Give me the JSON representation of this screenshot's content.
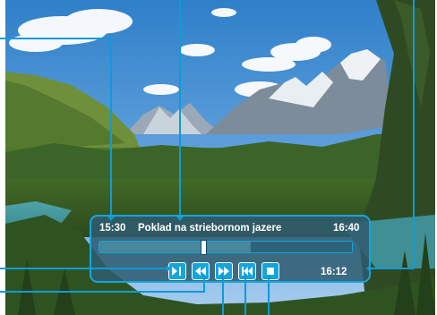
{
  "player": {
    "start_time": "15:30",
    "title": "Poklad na striebornom jazere",
    "end_time": "16:40",
    "current_time": "16:12",
    "progress_fraction": 0.6,
    "handle_fraction": 0.41
  },
  "buttons": [
    {
      "name": "play-pause-button",
      "icon": "play-pause-icon"
    },
    {
      "name": "rewind-button",
      "icon": "rewind-icon"
    },
    {
      "name": "fast-forward-button",
      "icon": "fast-forward-icon"
    },
    {
      "name": "skip-back-button",
      "icon": "skip-back-icon"
    },
    {
      "name": "stop-button",
      "icon": "stop-icon"
    }
  ],
  "colors": {
    "accent": "#13a5dd",
    "panel": "#2e5c70",
    "text": "#ffffff"
  }
}
